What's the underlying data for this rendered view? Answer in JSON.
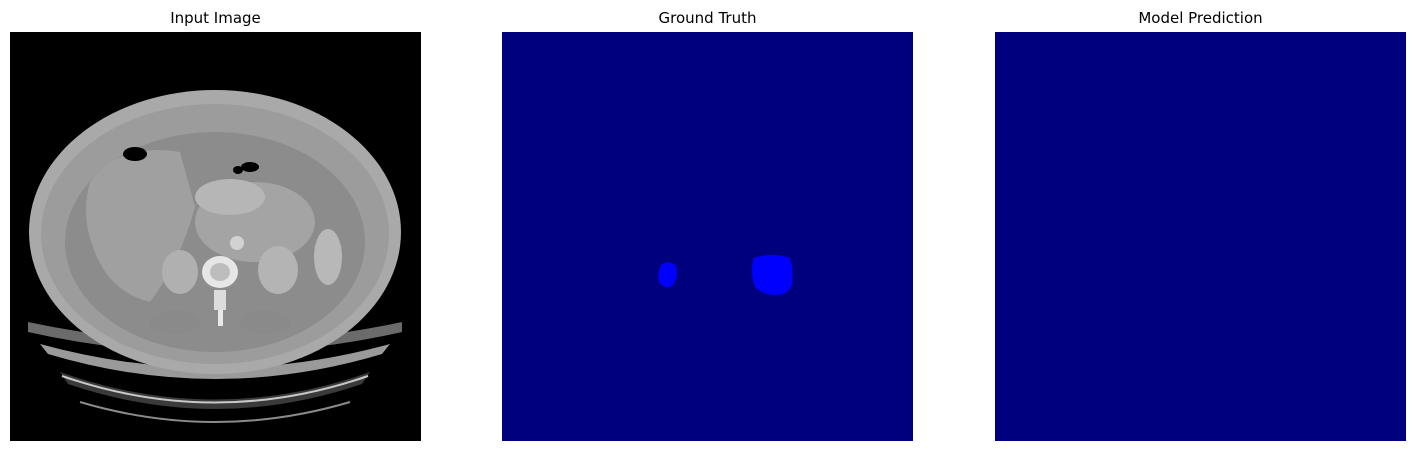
{
  "panels": [
    {
      "title": "Input Image"
    },
    {
      "title": "Ground Truth"
    },
    {
      "title": "Model Prediction"
    }
  ],
  "colors": {
    "ct_background": "#000000",
    "mask_background": "#00007f",
    "mask_foreground": "#0000ff"
  }
}
